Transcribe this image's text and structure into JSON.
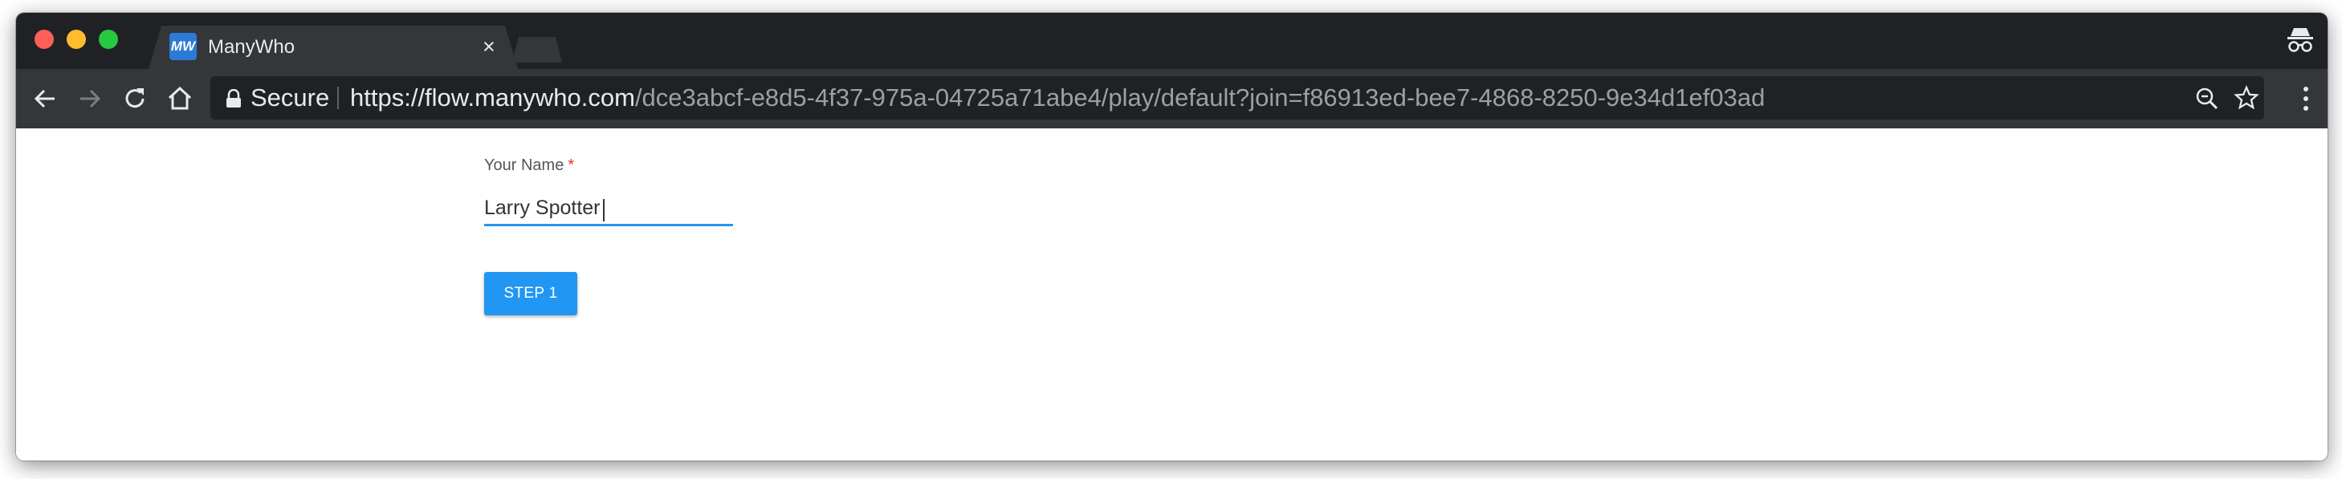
{
  "browser": {
    "tab": {
      "title": "ManyWho",
      "favicon_text": "MW",
      "close_glyph": "×"
    },
    "toolbar": {
      "secure_label": "Secure",
      "url_origin": "https://flow.manywho.com",
      "url_path": "/dce3abcf-e8d5-4f37-975a-04725a71abe4/play/default?join=f86913ed-bee7-4868-8250-9e34d1ef03ad"
    },
    "icons": [
      "close-dot",
      "minimize-dot",
      "maximize-dot",
      "incognito-icon",
      "back-arrow-icon",
      "forward-arrow-icon",
      "reload-icon",
      "home-icon",
      "lock-icon",
      "zoom-icon",
      "star-icon",
      "menu-icon"
    ],
    "colors": {
      "tabstrip": "#202124",
      "toolbar": "#35363a",
      "close": "#fe5f57",
      "minimize": "#febc2e",
      "maximize": "#28c840"
    }
  },
  "form": {
    "name_label": "Your Name",
    "required_mark": "*",
    "name_value": "Larry Spotter",
    "submit_label": "STEP 1",
    "accent_color": "#2196f3"
  }
}
